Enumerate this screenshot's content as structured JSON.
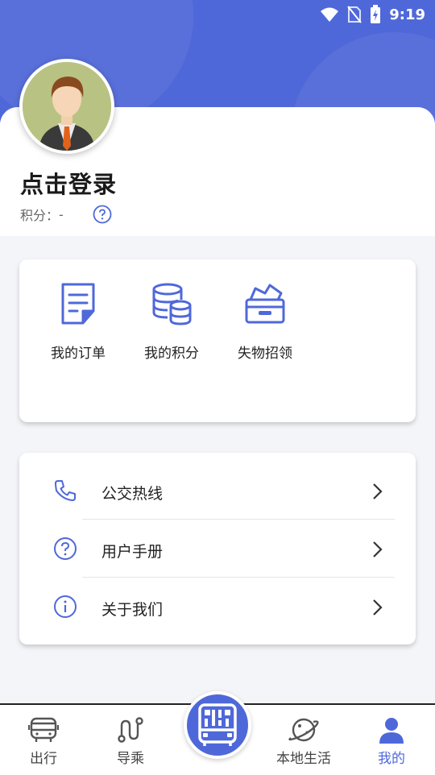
{
  "status_bar": {
    "time": "9:19",
    "icons": [
      "wifi-icon",
      "no-sim-icon",
      "battery-charging-icon"
    ]
  },
  "profile": {
    "avatar_icon": "businessman-avatar",
    "login_text": "点击登录",
    "points_label": "积分：",
    "points_value": "-",
    "help_icon": "question-circle-icon"
  },
  "quick_actions": [
    {
      "label": "我的订单",
      "icon": "order-document-icon"
    },
    {
      "label": "我的积分",
      "icon": "coins-stack-icon"
    },
    {
      "label": "失物招领",
      "icon": "lost-found-box-icon"
    }
  ],
  "menu": [
    {
      "label": "公交热线",
      "icon": "phone-icon"
    },
    {
      "label": "用户手册",
      "icon": "question-circle-icon"
    },
    {
      "label": "关于我们",
      "icon": "info-icon"
    }
  ],
  "bottom_nav": {
    "items": [
      {
        "label": "出行",
        "icon": "bus-icon",
        "active": false
      },
      {
        "label": "导乘",
        "icon": "route-icon",
        "active": false
      },
      {
        "label": "本地生活",
        "icon": "planet-icon",
        "active": false
      },
      {
        "label": "我的",
        "icon": "user-icon",
        "active": true
      }
    ],
    "center_icon": "qr-bus-code-icon"
  },
  "colors": {
    "accent": "#4f68d9",
    "background": "#f4f5f9",
    "text": "#222222"
  }
}
